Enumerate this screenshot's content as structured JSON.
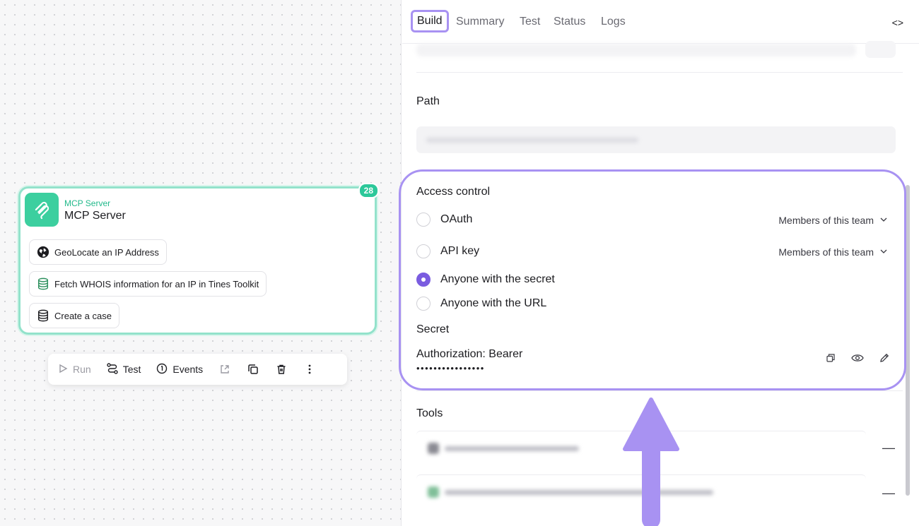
{
  "canvas": {
    "node": {
      "badge": "28",
      "type_label": "MCP Server",
      "title": "MCP Server",
      "tools": [
        {
          "label": "GeoLocate an IP Address",
          "icon": "globe-icon"
        },
        {
          "label": "Fetch WHOIS information for an IP in Tines Toolkit",
          "icon": "stack-icon"
        },
        {
          "label": "Create a case",
          "icon": "database-icon"
        }
      ]
    },
    "toolbar": {
      "run": "Run",
      "test": "Test",
      "events": "Events"
    }
  },
  "panel": {
    "tabs": [
      "Build",
      "Summary",
      "Test",
      "Status",
      "Logs"
    ],
    "active_tab": "Build",
    "code_toggle": "<>",
    "path_label": "Path",
    "access_control": {
      "title": "Access control",
      "options": [
        {
          "label": "OAuth",
          "scope": "Members of this team",
          "selected": false
        },
        {
          "label": "API key",
          "scope": "Members of this team",
          "selected": false
        },
        {
          "label": "Anyone with the secret",
          "scope": "",
          "selected": true
        },
        {
          "label": "Anyone with the URL",
          "scope": "",
          "selected": false
        }
      ],
      "secret_title": "Secret",
      "secret_header": "Authorization: Bearer",
      "secret_mask": "••••••••••••••••"
    },
    "tools_label": "Tools",
    "tool_row_dash": "—"
  },
  "colors": {
    "accent_purple": "#a892f2",
    "radio_selected": "#7a5ce0",
    "mcp_green": "#3ccf9f",
    "node_border": "#93e2cb"
  }
}
